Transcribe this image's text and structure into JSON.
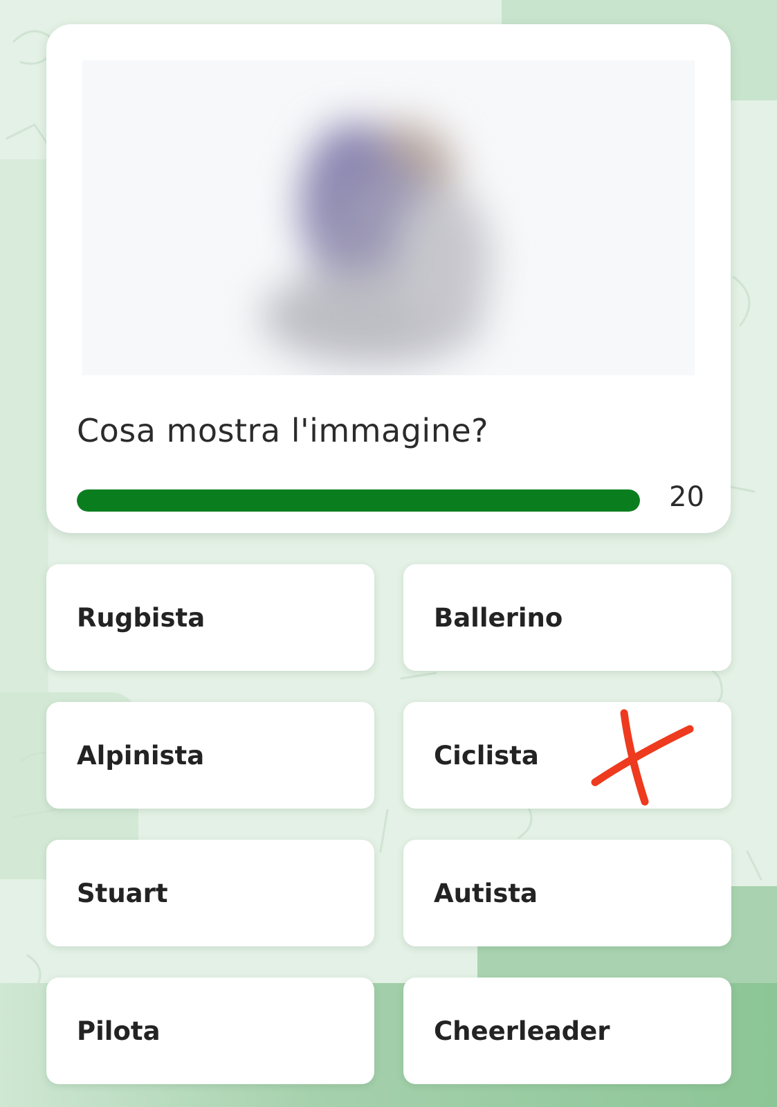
{
  "quiz": {
    "question": "Cosa mostra l'immagine?",
    "timer_value": "20",
    "progress_fraction": 1.0,
    "progress_color": "#0a7e1e",
    "image_alt": "blurred-person-photo"
  },
  "answers": [
    {
      "label": "Rugbista"
    },
    {
      "label": "Ballerino"
    },
    {
      "label": "Alpinista"
    },
    {
      "label": "Ciclista",
      "marked_wrong": true
    },
    {
      "label": "Stuart"
    },
    {
      "label": "Autista"
    },
    {
      "label": "Pilota"
    },
    {
      "label": "Cheerleader"
    }
  ],
  "colors": {
    "background": "#e4f1e6",
    "card": "#ffffff",
    "wrong_mark": "#ee3a1e"
  }
}
